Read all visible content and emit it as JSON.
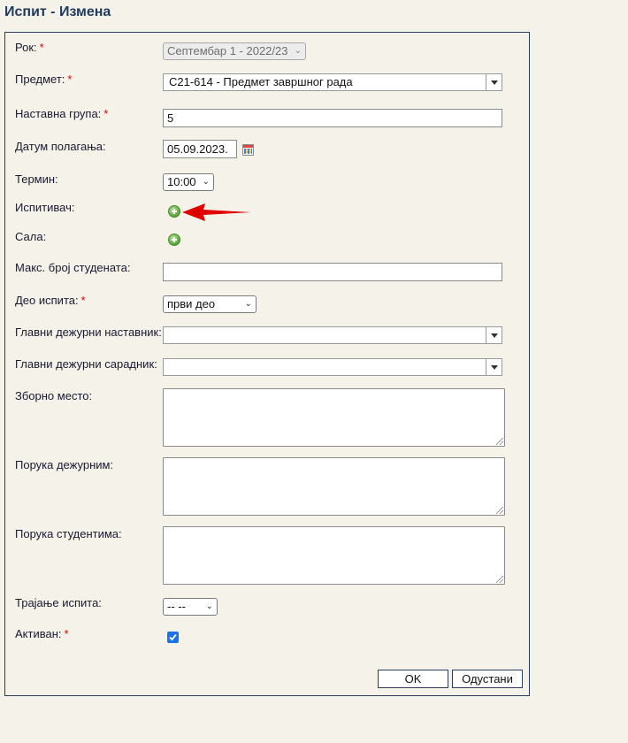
{
  "page": {
    "title": "Испит - Измена"
  },
  "form": {
    "required_mark": "*",
    "rok": {
      "label": "Рок:",
      "value": "Септембар 1 - 2022/23"
    },
    "predmet": {
      "label": "Предмет:",
      "value": "С21-614 - Предмет завршног рада"
    },
    "nastavna_grupa": {
      "label": "Наставна група:",
      "value": "5"
    },
    "datum": {
      "label": "Датум полагања:",
      "value": "05.09.2023."
    },
    "termin": {
      "label": "Термин:",
      "value": "10:00"
    },
    "ispitivac": {
      "label": "Испитивач:"
    },
    "sala": {
      "label": "Сала:"
    },
    "maks_broj": {
      "label": "Макс. број студената:",
      "value": ""
    },
    "deo_ispita": {
      "label": "Део испита:",
      "value": "први део"
    },
    "glavni_nastavnik": {
      "label": "Главни дежурни наставник:",
      "value": ""
    },
    "glavni_saradnik": {
      "label": "Главни дежурни сарадник:",
      "value": ""
    },
    "zborno_mesto": {
      "label": "Зборно место:",
      "value": ""
    },
    "poruka_dezurnim": {
      "label": "Порука дежурним:",
      "value": ""
    },
    "poruka_studentima": {
      "label": "Порука студентима:",
      "value": ""
    },
    "trajanje": {
      "label": "Трајање испита:",
      "value": "-- --"
    },
    "aktivan": {
      "label": "Активан:",
      "checked": true
    },
    "buttons": {
      "ok": "OK",
      "cancel": "Одустани"
    }
  },
  "icons": {
    "add": "plus-circle-icon",
    "calendar": "calendar-icon",
    "annotation": "red-arrow-icon"
  },
  "colors": {
    "background": "#f5f2ea",
    "title": "#1f3a5f",
    "required": "#d40000",
    "annotation": "#e00000",
    "checkbox": "#1a73e8"
  }
}
